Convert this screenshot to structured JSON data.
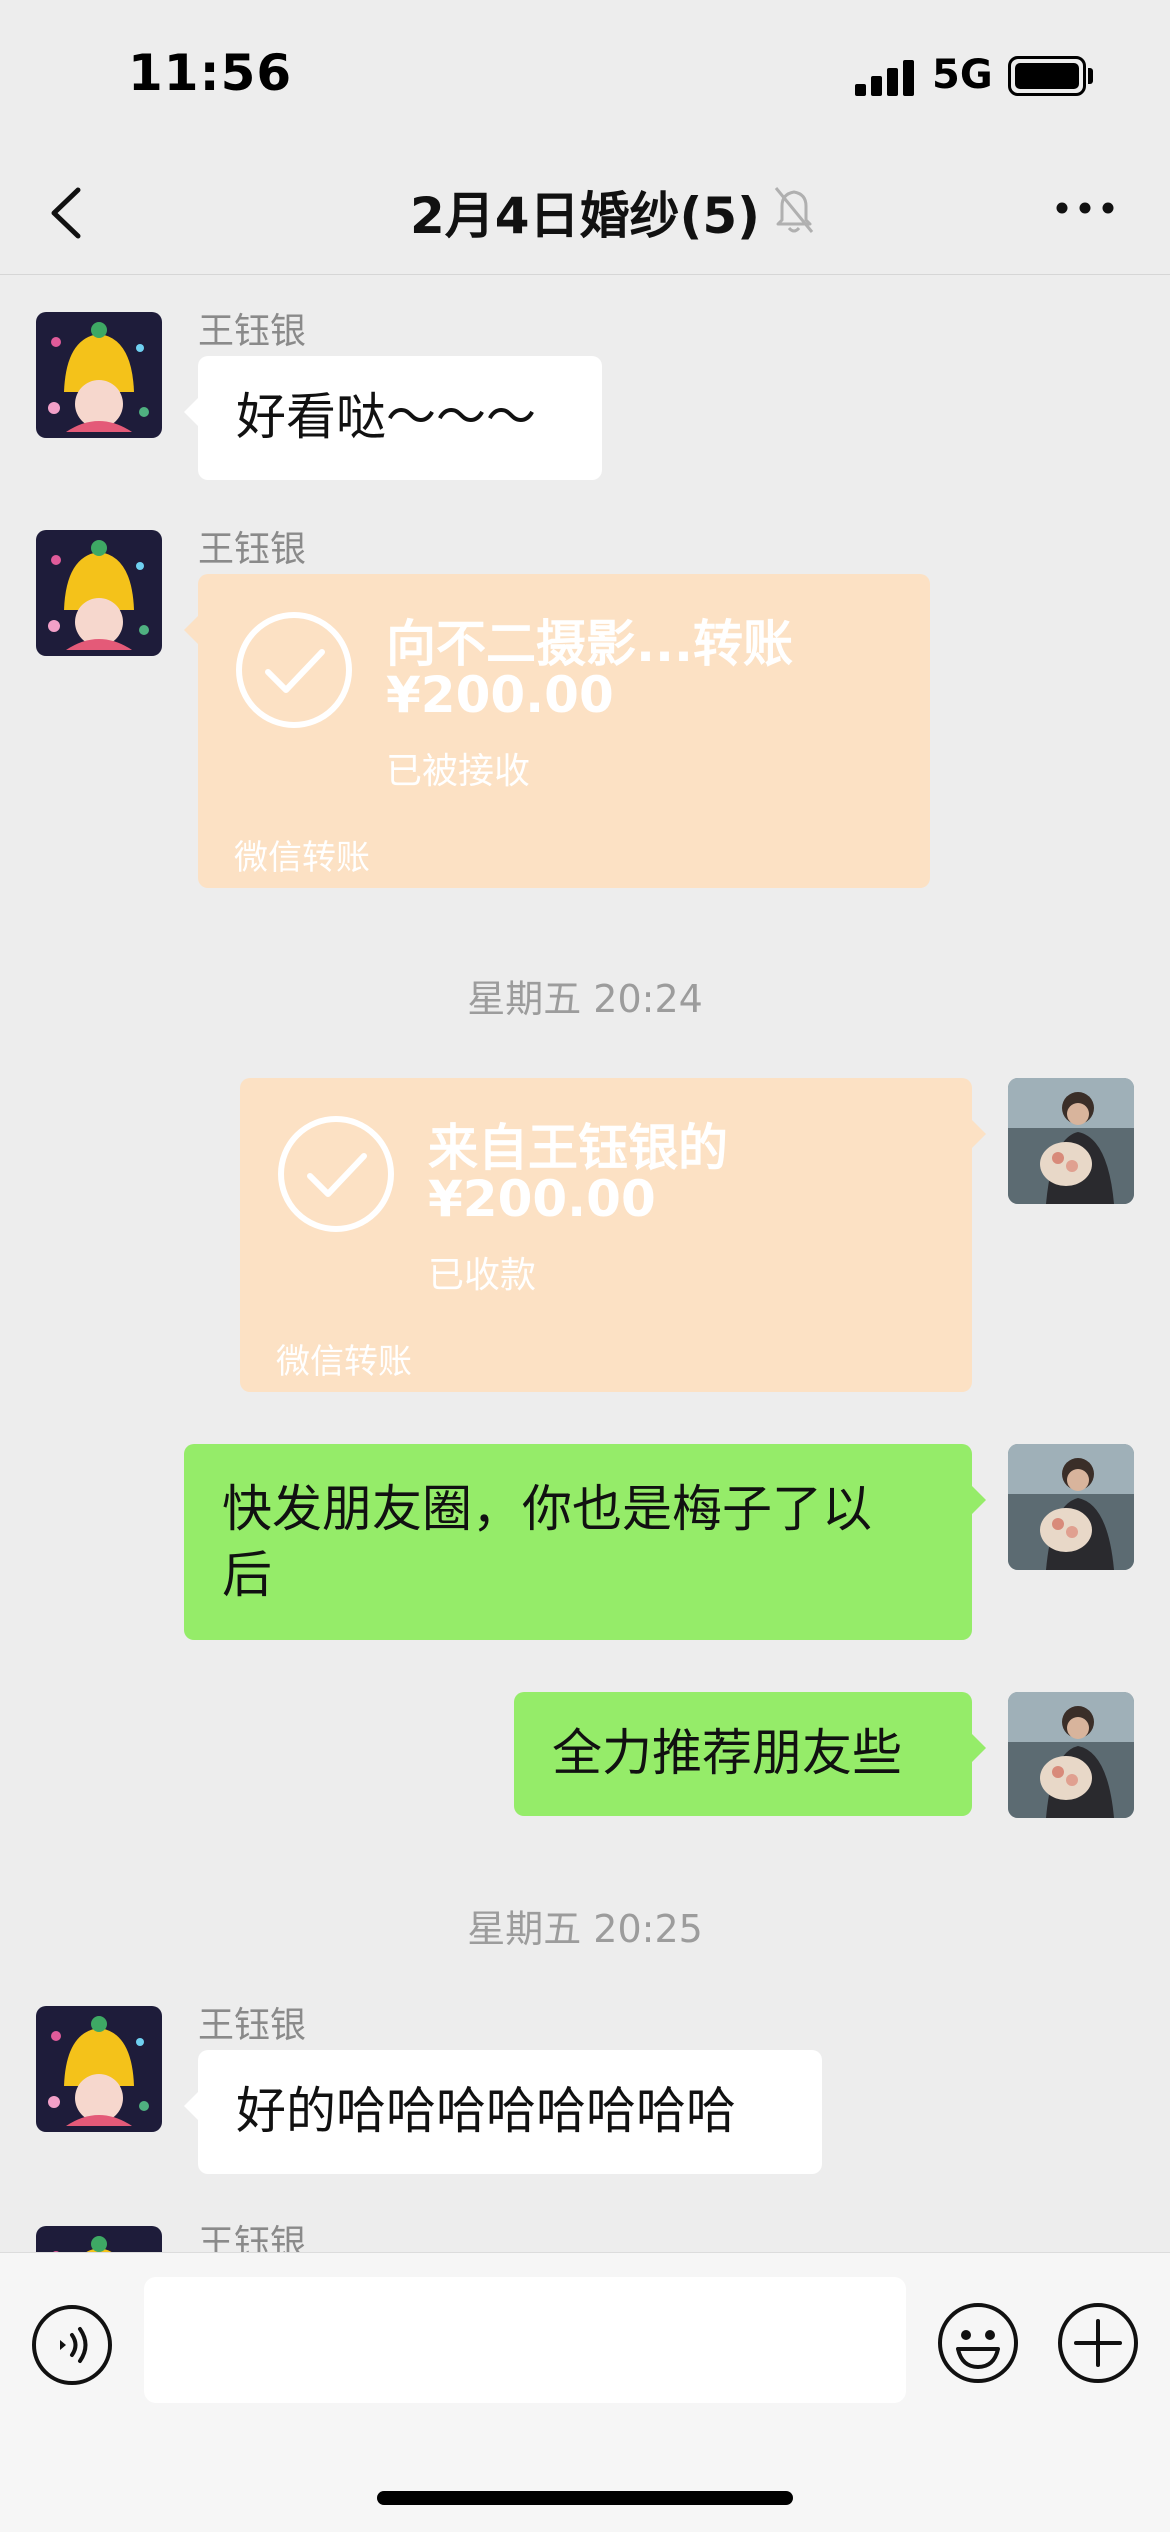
{
  "status_bar": {
    "time": "11:56",
    "network": "5G",
    "signal_icon": "signal-bars-icon",
    "battery_icon": "battery-full-icon"
  },
  "nav": {
    "back_icon": "chevron-left-icon",
    "title": "2月4日婚纱(5)",
    "mute_icon": "bell-slash-icon",
    "more_icon": "ellipsis-icon"
  },
  "messages": [
    {
      "type": "text",
      "direction": "incoming",
      "sender": "王钰银",
      "text": "好看哒～～～"
    },
    {
      "type": "transfer",
      "direction": "incoming",
      "sender": "王钰银",
      "title": "向不二摄影...转账",
      "amount": "¥200.00",
      "status": "已被接收",
      "footer": "微信转账"
    },
    {
      "type": "timestamp",
      "text": "星期五 20:24"
    },
    {
      "type": "transfer",
      "direction": "outgoing",
      "title": "来自王钰银的",
      "amount": "¥200.00",
      "status": "已收款",
      "footer": "微信转账"
    },
    {
      "type": "text",
      "direction": "outgoing",
      "lines": [
        "快发朋友圈，你也是梅子了以",
        "后"
      ]
    },
    {
      "type": "text",
      "direction": "outgoing",
      "text": "全力推荐朋友些"
    },
    {
      "type": "timestamp",
      "text": "星期五 20:25"
    },
    {
      "type": "text",
      "direction": "incoming",
      "sender": "王钰银",
      "text": "好的哈哈哈哈哈哈哈哈"
    },
    {
      "type": "partial",
      "direction": "incoming",
      "sender": "王钰银"
    }
  ],
  "input_bar": {
    "voice_icon": "voice-input-icon",
    "input_value": "",
    "emoji_icon": "emoji-icon",
    "plus_icon": "plus-circle-icon"
  },
  "colors": {
    "background": "#ededed",
    "incoming_bubble": "#ffffff",
    "outgoing_bubble": "#95ec69",
    "transfer_card": "#fce1c4",
    "muted_text": "#8a8a8a"
  }
}
